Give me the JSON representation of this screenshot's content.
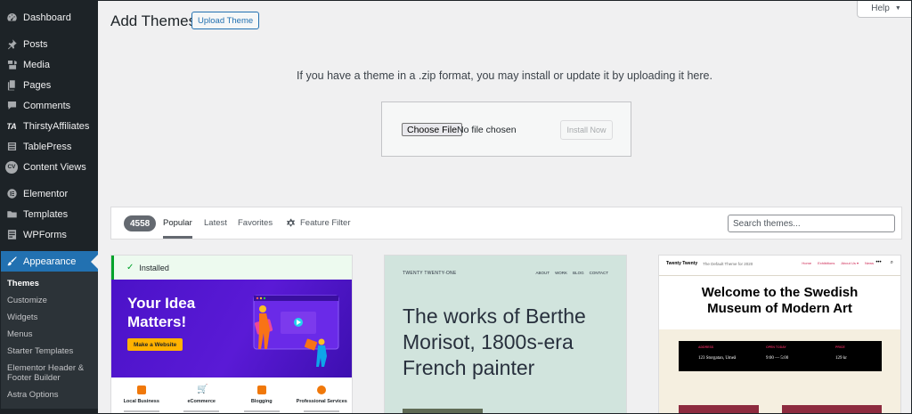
{
  "sidebar": {
    "items": [
      {
        "label": "Dashboard",
        "icon": "dashboard-icon"
      },
      {
        "label": "Posts",
        "icon": "pin-icon"
      },
      {
        "label": "Media",
        "icon": "media-icon"
      },
      {
        "label": "Pages",
        "icon": "pages-icon"
      },
      {
        "label": "Comments",
        "icon": "comment-icon"
      },
      {
        "label": "ThirstyAffiliates",
        "icon": "ta-icon",
        "glyph": "TA"
      },
      {
        "label": "TablePress",
        "icon": "table-icon"
      },
      {
        "label": "Content Views",
        "icon": "cv-icon",
        "glyph": "CV"
      },
      {
        "label": "Elementor",
        "icon": "elementor-icon"
      },
      {
        "label": "Templates",
        "icon": "folder-icon"
      },
      {
        "label": "WPForms",
        "icon": "wpforms-icon"
      },
      {
        "label": "Appearance",
        "icon": "brush-icon"
      }
    ],
    "submenu": [
      "Themes",
      "Customize",
      "Widgets",
      "Menus",
      "Starter Templates",
      "Elementor Header & Footer Builder",
      "Astra Options"
    ]
  },
  "header": {
    "title": "Add Themes",
    "upload_button": "Upload Theme",
    "help": "Help",
    "help_arrow": "▼"
  },
  "upload": {
    "instructions": "If you have a theme in a .zip format, you may install or update it by uploading it here.",
    "choose_file": "Choose File",
    "no_file": "No file chosen",
    "install_now": "Install Now"
  },
  "filter": {
    "count": "4558",
    "tabs": [
      "Popular",
      "Latest",
      "Favorites"
    ],
    "feature_filter": "Feature Filter",
    "search_placeholder": "Search themes..."
  },
  "themes": [
    {
      "installed_label": "Installed",
      "hero_title": "Your Idea\nMatters!",
      "cta": "Make a Website",
      "features": [
        "Local Business",
        "eCommerce",
        "Blogging",
        "Professional Services"
      ]
    },
    {
      "site_name": "TWENTY TWENTY-ONE",
      "nav": [
        "ABOUT",
        "WORK",
        "BLOG",
        "CONTACT"
      ],
      "headline": "The works of Berthe\nMorisot, 1800s-era\nFrench painter"
    },
    {
      "site_name": "Twenty Twenty",
      "tagline": "The Default Theme for 2020",
      "menu": [
        "Home",
        "Exhibitions",
        "About Us ▾",
        "News"
      ],
      "headline": "Welcome to the Swedish\nMuseum of Modern Art",
      "info": [
        {
          "label": "ADDRESS",
          "value": "123 Storgatan, Umeå"
        },
        {
          "label": "OPEN TODAY",
          "value": "9:00 — 5:00"
        },
        {
          "label": "PRICE",
          "value": "129 kr"
        }
      ]
    }
  ],
  "colors": {
    "sidebar_bg": "#1d2327",
    "accent": "#2271b1",
    "installed_green": "#00a32a",
    "astra_purple": "#5a1ad6",
    "tt1_green": "#d1e4dd",
    "tt_accent": "#cd2653"
  }
}
